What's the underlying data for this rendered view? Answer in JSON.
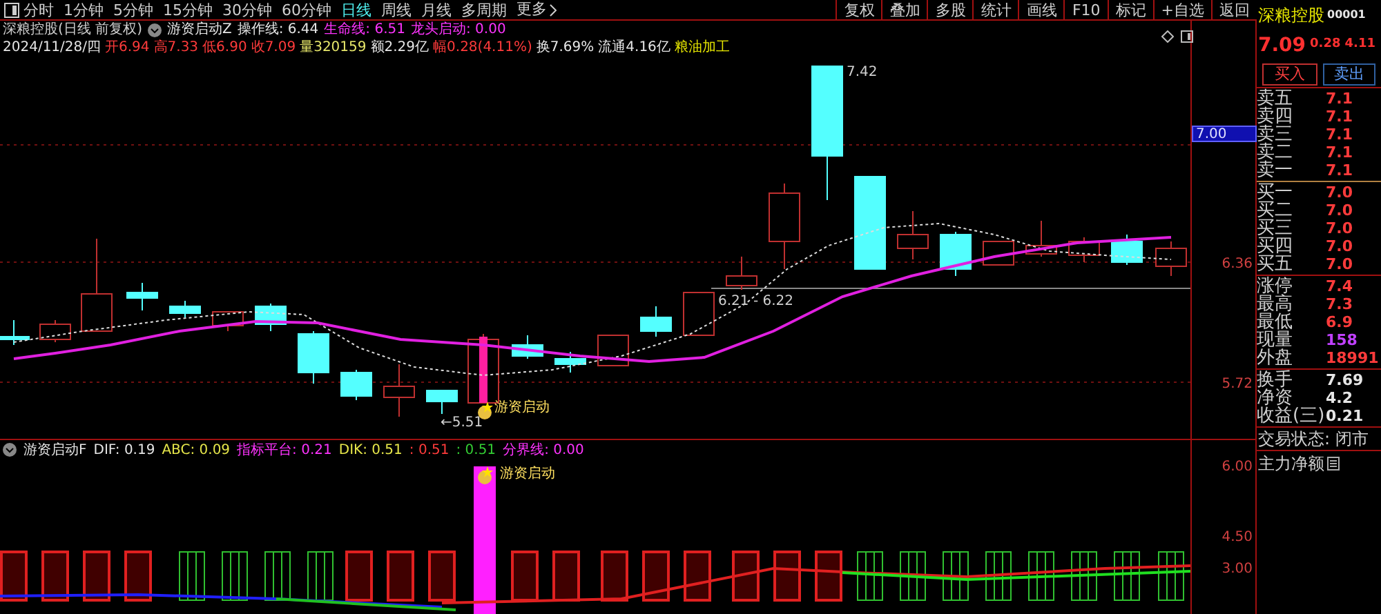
{
  "toolbar": {
    "tabs": [
      {
        "label": "分时",
        "selected": false
      },
      {
        "label": "1分钟",
        "selected": false
      },
      {
        "label": "5分钟",
        "selected": false
      },
      {
        "label": "15分钟",
        "selected": false
      },
      {
        "label": "30分钟",
        "selected": false
      },
      {
        "label": "60分钟",
        "selected": false
      },
      {
        "label": "日线",
        "selected": true
      },
      {
        "label": "周线",
        "selected": false
      },
      {
        "label": "月线",
        "selected": false
      },
      {
        "label": "多周期",
        "selected": false
      }
    ],
    "more": "更多",
    "actions": [
      "复权",
      "叠加",
      "多股",
      "统计",
      "画线",
      "F10",
      "标记",
      "+自选",
      "返回"
    ]
  },
  "main_chart": {
    "title": "深粮控股(日线 前复权)",
    "indicator": "游资启动Z",
    "params": [
      {
        "text": "操作线: 6.44",
        "color": "#e6e6e6"
      },
      {
        "text": "生命线: 6.51",
        "color": "#ff33ff"
      },
      {
        "text": "龙头启动: 0.00",
        "color": "#ff33ff"
      }
    ],
    "quote_line": [
      {
        "text": "2024/11/28/四",
        "color": "#e6e6e6"
      },
      {
        "text": "开6.94",
        "color": "#ff3b3b"
      },
      {
        "text": "高7.33",
        "color": "#ff3b3b"
      },
      {
        "text": "低6.90",
        "color": "#ff3b3b"
      },
      {
        "text": "收7.09",
        "color": "#ff3b3b"
      },
      {
        "text": "量320159",
        "color": "#e6e66a"
      },
      {
        "text": "额2.29亿",
        "color": "#e6e6e6"
      },
      {
        "text": "幅0.28(4.11%)",
        "color": "#ff3b3b"
      },
      {
        "text": "换7.69%",
        "color": "#e6e6e6"
      },
      {
        "text": "流通4.16亿",
        "color": "#e6e6e6"
      },
      {
        "text": "粮油加工",
        "color": "#e6e600"
      }
    ],
    "high_label": "7.42",
    "range_label": "6.21 - 6.22",
    "low_label": "←5.51",
    "signal_label": "游资启动",
    "axis": {
      "current": "7.00",
      "ticks": [
        "6.36",
        "5.72"
      ]
    }
  },
  "indicator_pane": {
    "name": "游资启动F",
    "params": [
      {
        "text": "DIF: 0.19",
        "color": "#e6e6e6"
      },
      {
        "text": "ABC: 0.09",
        "color": "#e6e64a"
      },
      {
        "text": "指标平台: 0.21",
        "color": "#ff33ff"
      },
      {
        "text": "DIK: 0.51",
        "color": "#e6e64a"
      },
      {
        "text": ": 0.51",
        "color": "#ff3b3b"
      },
      {
        "text": ": 0.51",
        "color": "#33cc33"
      },
      {
        "text": "分界线: 0.00",
        "color": "#ff33ff"
      }
    ],
    "signal_label": "游资启动",
    "ticks": [
      "6.00",
      "4.50",
      "3.00"
    ]
  },
  "quote_panel": {
    "name": "深粮控股",
    "code": "00001",
    "price": "7.09",
    "change": "0.28",
    "percent": "4.11",
    "buy": "买入",
    "sell": "卖出",
    "asks": [
      {
        "label": "卖五",
        "value": "7.1"
      },
      {
        "label": "卖四",
        "value": "7.1"
      },
      {
        "label": "卖三",
        "value": "7.1"
      },
      {
        "label": "卖二",
        "value": "7.1"
      },
      {
        "label": "卖一",
        "value": "7.1"
      }
    ],
    "bids": [
      {
        "label": "买一",
        "value": "7.0"
      },
      {
        "label": "买二",
        "value": "7.0"
      },
      {
        "label": "买三",
        "value": "7.0"
      },
      {
        "label": "买四",
        "value": "7.0"
      },
      {
        "label": "买五",
        "value": "7.0"
      }
    ],
    "stats": [
      {
        "label": "涨停",
        "value": "7.4",
        "color": "#ff3b3b"
      },
      {
        "label": "最高",
        "value": "7.3",
        "color": "#ff3b3b"
      },
      {
        "label": "最低",
        "value": "6.9",
        "color": "#ff3b3b"
      },
      {
        "label": "现量",
        "value": "158",
        "color": "#c040ff"
      },
      {
        "label": "外盘",
        "value": "18991",
        "color": "#ff3b3b"
      }
    ],
    "fundamentals": [
      {
        "label": "换手",
        "value": "7.69"
      },
      {
        "label": "净资",
        "value": "4.2"
      },
      {
        "label": "收益(三)",
        "value": "0.21"
      }
    ],
    "status": "交易状态: 闭市",
    "main_net": "主力净额"
  }
}
